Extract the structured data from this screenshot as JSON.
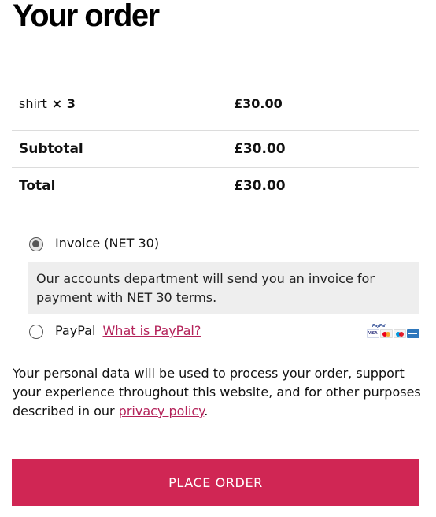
{
  "page": {
    "title": "Your order"
  },
  "order": {
    "item": {
      "name": "shirt",
      "quantity": "× 3",
      "price": "£30.00"
    },
    "subtotal": {
      "label": "Subtotal",
      "value": "£30.00"
    },
    "total": {
      "label": "Total",
      "value": "£30.00"
    }
  },
  "payment": {
    "invoice": {
      "label": "Invoice (NET 30)",
      "selected": true,
      "description": "Our accounts department will send you an invoice for payment with NET 30 terms."
    },
    "paypal": {
      "label": "PayPal",
      "link_text": "What is PayPal?",
      "selected": false,
      "card_icons": [
        "paypal-logo-icon",
        "visa-icon",
        "mastercard-icon",
        "maestro-icon",
        "amex-icon"
      ]
    }
  },
  "privacy": {
    "text_before": "Your personal data will be used to process your order, support your experience throughout this website, and for other purposes described in our ",
    "link_text": "privacy policy",
    "text_after": "."
  },
  "actions": {
    "place_order_label": "PLACE ORDER"
  },
  "colors": {
    "accent": "#d02654",
    "link": "#b4235a",
    "description_bg": "#eeeeee"
  }
}
